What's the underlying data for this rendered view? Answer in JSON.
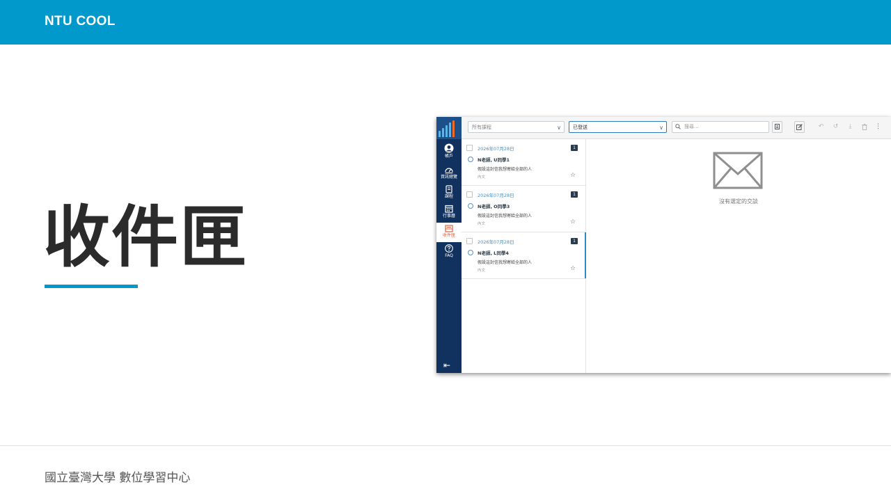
{
  "header": {
    "brand": "NTU COOL",
    "bar_color": "#0198cb"
  },
  "slide": {
    "title": "收件匣"
  },
  "footer": {
    "org": "國立臺灣大學 數位學習中心"
  },
  "app": {
    "sidebar": {
      "items": [
        {
          "label": "帳戶",
          "icon": "account-icon"
        },
        {
          "label": "資訊總覽",
          "icon": "dashboard-icon"
        },
        {
          "label": "課程",
          "icon": "courses-icon"
        },
        {
          "label": "行事曆",
          "icon": "calendar-icon"
        },
        {
          "label": "收件匣",
          "icon": "inbox-icon",
          "active": true
        },
        {
          "label": "FAQ",
          "icon": "help-icon"
        }
      ],
      "collapse_glyph": "⇤"
    },
    "toolbar": {
      "course_filter": "所有課程",
      "type_filter": "已發送",
      "search_placeholder": "搜尋..."
    },
    "messages": [
      {
        "date": "2026年07月28日",
        "count": "1",
        "participants": "N老師, U同學1",
        "subject": "假設這封信我想寄給全部的人",
        "snippet": "內文"
      },
      {
        "date": "2026年07月28日",
        "count": "1",
        "participants": "N老師, O同學3",
        "subject": "假設這封信我想寄給全部的人",
        "snippet": "內文"
      },
      {
        "date": "2026年07月28日",
        "count": "1",
        "participants": "N老師, L同學4",
        "subject": "假設這封信我想寄給全部的人",
        "snippet": "內文",
        "selected": true
      }
    ],
    "detail": {
      "empty_text": "沒有選定的交談"
    }
  }
}
